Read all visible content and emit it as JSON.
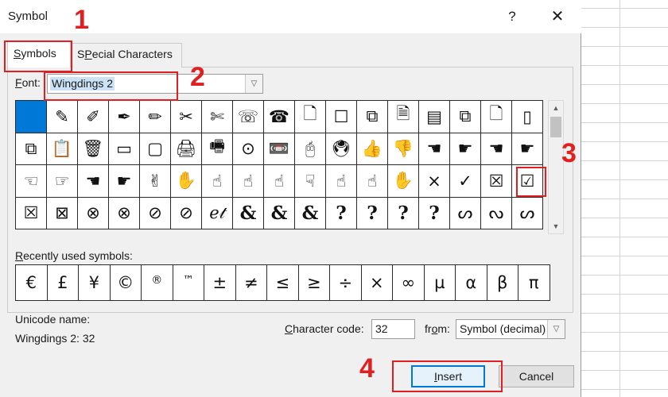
{
  "window": {
    "title": "Symbol",
    "help_glyph": "?",
    "close_glyph": "✕"
  },
  "tabs": [
    {
      "label": "Symbols",
      "mnemonic": "S",
      "rest": "ymbols",
      "active": true
    },
    {
      "label": "Special Characters",
      "mnemonic": "P",
      "prefix": "S",
      "rest": "ecial Characters",
      "active": false
    }
  ],
  "font": {
    "label_mnemonic": "F",
    "label_rest": "ont:",
    "value": "Wingdings 2",
    "dropdown_glyph": "▽"
  },
  "symbol_grid": {
    "selected_index": 0,
    "cells": [
      "",
      "✎",
      "✐",
      "✒",
      "✏",
      "✂",
      "✄",
      "☏",
      "☎",
      "🗋",
      "☐",
      "⧉",
      "🗎",
      "▤",
      "⧉",
      "🗋",
      "▯",
      "⧉",
      "📋",
      "🗑",
      "▭",
      "▢",
      "🖨",
      "🖷",
      "⊙",
      "📼",
      "🖰",
      "🖲",
      "👍",
      "👎",
      "☚",
      "☛",
      "☚",
      "☛",
      "☜",
      "☞",
      "☚",
      "☛",
      "✌",
      "✋",
      "☝",
      "☝",
      "☝",
      "☟",
      "☝",
      "☝",
      "✋",
      "×",
      "✓",
      "☒",
      "☑",
      "☒",
      "⊠",
      "⊗",
      "⊗",
      "⊘",
      "⊘",
      "ℯ𝓉",
      "&",
      "&",
      "&",
      "?",
      "?",
      "?",
      "?",
      "ᔕ",
      "ᔓ",
      "ᔕ"
    ]
  },
  "scrollbar": {
    "up_glyph": "▲",
    "down_glyph": "▼"
  },
  "recent": {
    "label_mnemonic": "R",
    "label_rest": "ecently used symbols:",
    "symbols": [
      "€",
      "£",
      "¥",
      "©",
      "®",
      "™",
      "±",
      "≠",
      "≤",
      "≥",
      "÷",
      "×",
      "∞",
      "µ",
      "α",
      "β",
      "π"
    ]
  },
  "unicode_name": {
    "label": "Unicode name:",
    "value": "Wingdings 2: 32"
  },
  "character_code": {
    "label_mnemonic": "C",
    "label_rest": "haracter code:",
    "value": "32"
  },
  "from": {
    "label_prefix": "fr",
    "label_mnemonic": "o",
    "label_rest": "m:",
    "value": "Symbol (decimal)",
    "dropdown_glyph": "▽"
  },
  "buttons": {
    "insert_mnemonic": "I",
    "insert_rest": "nsert",
    "cancel": "Cancel"
  },
  "annotations": {
    "step1": "1",
    "step2": "2",
    "step3": "3",
    "step4": "4",
    "color": "#e02020"
  }
}
